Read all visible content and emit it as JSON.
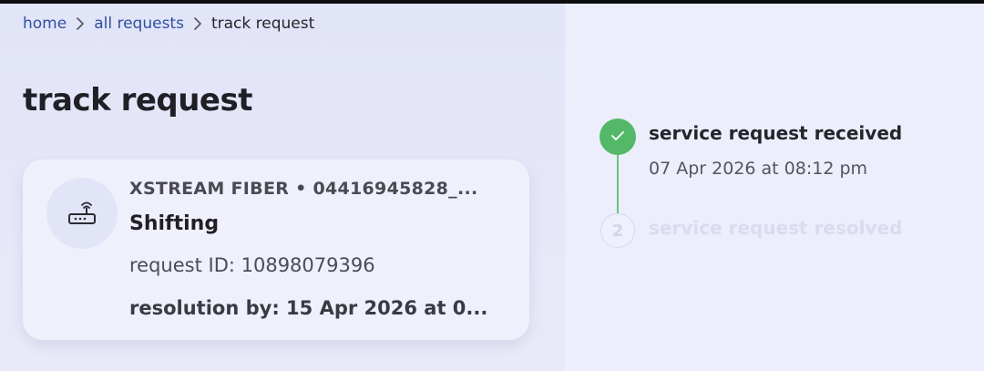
{
  "breadcrumb": {
    "home": "home",
    "all_requests": "all requests",
    "current": "track request"
  },
  "page": {
    "title": "track request"
  },
  "request_card": {
    "service_line": "XSTREAM FIBER • 04416945828_...",
    "request_type": "Shifting",
    "request_id": "request ID: 10898079396",
    "resolution": "resolution by: 15 Apr 2026 at 0...",
    "icon": "router-icon"
  },
  "timeline": {
    "steps": [
      {
        "number": "",
        "title": "service request received",
        "date": "07 Apr 2026 at 08:12 pm",
        "status": "completed",
        "icon": "check-icon"
      },
      {
        "number": "2",
        "title": "service request resolved",
        "date": "",
        "status": "pending"
      }
    ]
  },
  "colors": {
    "accent_link": "#2f4fa0",
    "completed_green": "#53b868",
    "pending_gray": "#d9dbef",
    "left_panel_bg": "#e4e6f8",
    "right_panel_bg": "#eceefb"
  }
}
